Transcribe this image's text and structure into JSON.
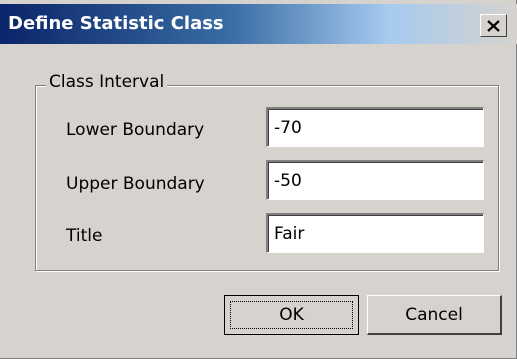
{
  "dialog": {
    "title": "Define Statistic Class",
    "close_icon": "close-icon"
  },
  "class_interval": {
    "group_label": "Class Interval",
    "lower_boundary": {
      "label": "Lower Boundary",
      "value": "-70"
    },
    "upper_boundary": {
      "label": "Upper Boundary",
      "value": "-50"
    },
    "title_field": {
      "label": "Title",
      "value": "Fair"
    }
  },
  "buttons": {
    "ok_label": "OK",
    "cancel_label": "Cancel"
  },
  "colors": {
    "titlebar_start": "#0a246a",
    "titlebar_end": "#a6caf0",
    "dialog_face": "#d6d3ce"
  }
}
